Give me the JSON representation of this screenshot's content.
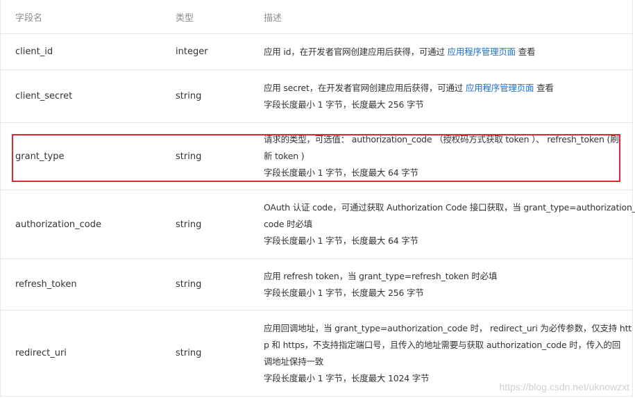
{
  "headers": {
    "name": "字段名",
    "type": "类型",
    "desc": "描述"
  },
  "rows": [
    {
      "name": "client_id",
      "type": "integer",
      "desc_pre": "应用 id，在开发者官网创建应用后获得，可通过 ",
      "desc_link": "应用程序管理页面",
      "desc_post": " 查看"
    },
    {
      "name": "client_secret",
      "type": "string",
      "desc_pre": "应用 secret，在开发者官网创建应用后获得，可通过 ",
      "desc_link": "应用程序管理页面",
      "desc_post": " 查看",
      "desc_line2": "字段长度最小 1 字节，长度最大 256 字节"
    },
    {
      "name": "grant_type",
      "type": "string",
      "desc_line1": "请求的类型，可选值： authorization_code （授权码方式获取 token ）、 refresh_token (刷",
      "desc_line2": "新 token )",
      "desc_line3": "字段长度最小 1 字节，长度最大 64 字节"
    },
    {
      "name": "authorization_code",
      "type": "string",
      "desc_line1": "OAuth 认证 code，可通过获取 Authorization Code 接口获取，当 grant_type=authorization_",
      "desc_line2": "code 时必填",
      "desc_line3": "字段长度最小 1 字节，长度最大 64 字节"
    },
    {
      "name": "refresh_token",
      "type": "string",
      "desc_line1": "应用 refresh token，当 grant_type=refresh_token 时必填",
      "desc_line2": "字段长度最小 1 字节，长度最大 256 字节"
    },
    {
      "name": "redirect_uri",
      "type": "string",
      "desc_line1": "应用回调地址，当 grant_type=authorization_code 时， redirect_uri 为必传参数，仅支持 htt",
      "desc_line2": "p 和 https，不支持指定端口号，且传入的地址需要与获取 authorization_code 时，传入的回",
      "desc_line3": "调地址保持一致",
      "desc_line4": "字段长度最小 1 字节，长度最大 1024 字节"
    }
  ],
  "watermark": "https://blog.csdn.net/uknowzxt",
  "highlight_color": "#e0272f",
  "link_color": "#1f6fd1"
}
